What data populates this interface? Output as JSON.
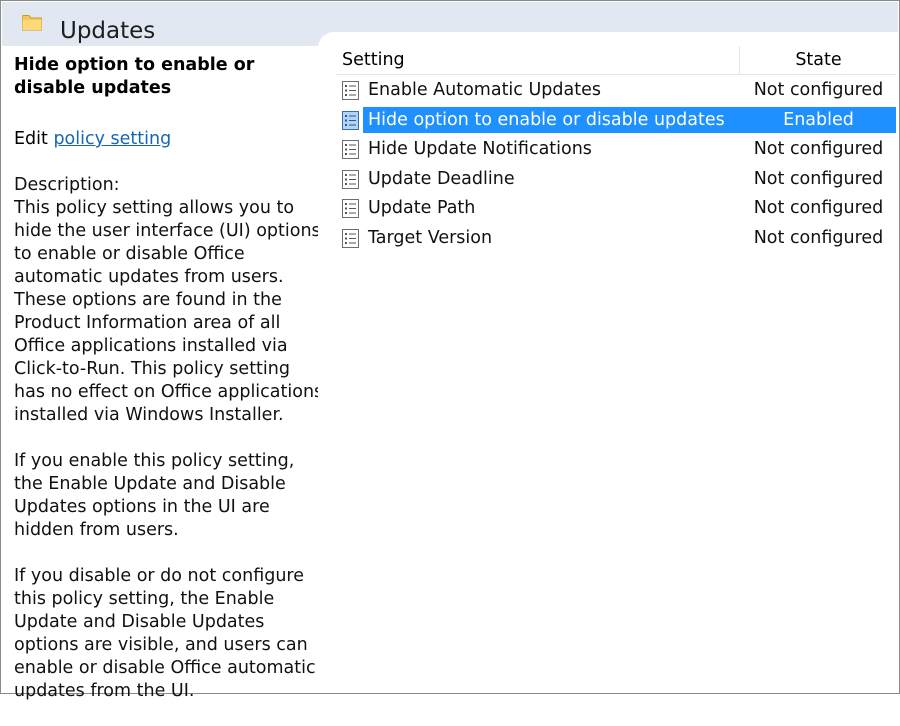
{
  "header": {
    "title": "Updates",
    "icon": "folder-icon"
  },
  "details": {
    "heading": "Hide option to enable or disable updates",
    "edit_prefix": "Edit ",
    "edit_link": "policy setting ",
    "description_label": "Description:",
    "paragraphs": [
      "This policy setting allows you to hide the user interface (UI) options to enable or disable Office automatic updates from users. These options are found in the Product Information area of all Office applications installed via Click-to-Run. This policy setting has no effect on Office applications installed via Windows Installer.",
      "If you enable this policy setting, the Enable Update and Disable Updates options in the UI are hidden from users.",
      "If you disable or do not configure this policy setting, the Enable Update and Disable Updates options are visible, and users can enable or disable Office automatic updates from the UI."
    ]
  },
  "table": {
    "columns": {
      "setting": "Setting",
      "state": "State"
    },
    "rows": [
      {
        "name": "Enable Automatic Updates",
        "state": "Not configured"
      },
      {
        "name": "Hide option to enable or disable updates",
        "state": "Enabled"
      },
      {
        "name": "Hide Update Notifications",
        "state": "Not configured"
      },
      {
        "name": "Update Deadline",
        "state": "Not configured"
      },
      {
        "name": "Update Path",
        "state": "Not configured"
      },
      {
        "name": "Target Version",
        "state": "Not configured"
      }
    ],
    "selected_row": "Hide option to enable or disable updates"
  },
  "colors": {
    "header_bg": "#e1e8f2",
    "selection": "#1e90ff",
    "link": "#1566b7",
    "folder": "#f4c75a"
  }
}
